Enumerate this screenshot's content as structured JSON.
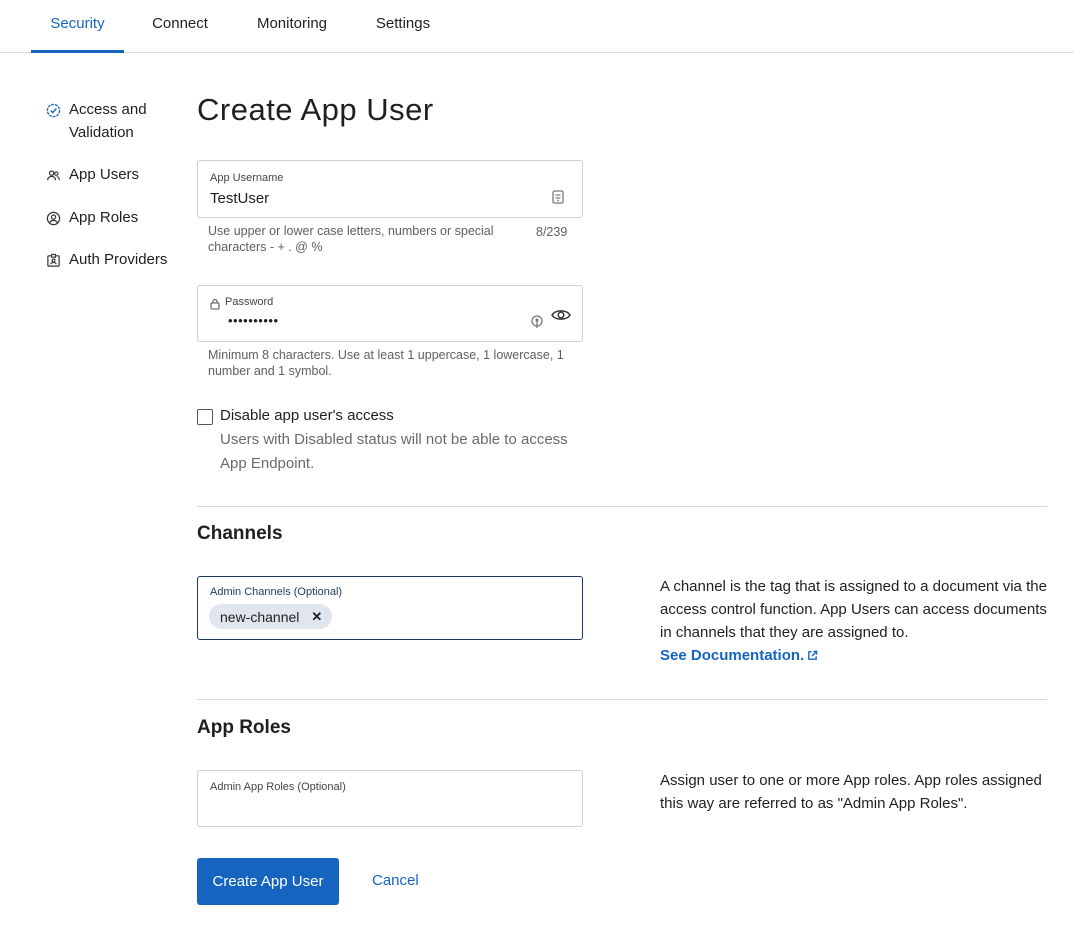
{
  "tabs": [
    {
      "label": "Security",
      "active": true
    },
    {
      "label": "Connect"
    },
    {
      "label": "Monitoring"
    },
    {
      "label": "Settings"
    }
  ],
  "sidebar": {
    "items": [
      {
        "label": "Access and Validation",
        "icon": "check-badge-icon"
      },
      {
        "label": "App Users",
        "icon": "users-icon"
      },
      {
        "label": "App Roles",
        "icon": "user-circle-icon"
      },
      {
        "label": "Auth Providers",
        "icon": "id-badge-icon"
      }
    ]
  },
  "page": {
    "title": "Create App User"
  },
  "username": {
    "label": "App Username",
    "value": "TestUser",
    "helper": "Use upper or lower case letters, numbers or special characters - + . @ %",
    "counter": "8/239"
  },
  "password": {
    "label": "Password",
    "value": "••••••••••",
    "helper": "Minimum 8 characters. Use at least 1 uppercase, 1 lowercase, 1 number and 1 symbol."
  },
  "disable_access": {
    "label": "Disable app user's access",
    "description": "Users with Disabled status will not be able to access App Endpoint.",
    "checked": false
  },
  "channels": {
    "title": "Channels",
    "field_label": "Admin Channels (Optional)",
    "chips": [
      "new-channel"
    ],
    "description": "A channel is the tag that is assigned to a document via the access control function. App Users can access documents in channels that they are assigned to.",
    "doc_link": "See Documentation."
  },
  "app_roles": {
    "title": "App Roles",
    "field_label": "Admin App Roles (Optional)",
    "description": "Assign user to one or more App roles. App roles assigned this way are referred to as \"Admin App Roles\"."
  },
  "actions": {
    "create": "Create App User",
    "cancel": "Cancel"
  },
  "colors": {
    "accent": "#1565c0",
    "chip_bg": "#dfe6ee",
    "border": "#cfcfcf"
  }
}
